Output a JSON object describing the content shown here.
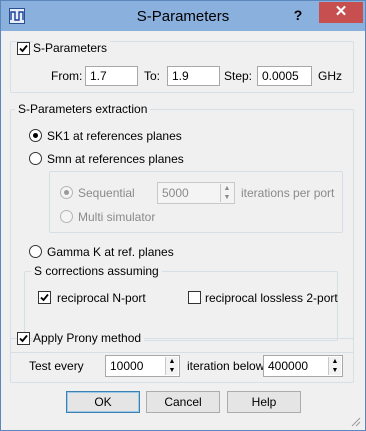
{
  "window": {
    "title": "S-Parameters",
    "help_label": "?",
    "close_label": "✕"
  },
  "sparams": {
    "checkbox_label": "S-Parameters",
    "checked": true,
    "from_label": "From:",
    "from_value": "1.7",
    "to_label": "To:",
    "to_value": "1.9",
    "step_label": "Step:",
    "step_value": "0.0005",
    "unit": "GHz"
  },
  "extraction": {
    "group_title": "S-Parameters extraction",
    "sk1_label": "SK1 at references planes",
    "smn_label": "Smn at references planes",
    "sequential_label": "Sequential",
    "sequential_value": "5000",
    "iterations_label": "iterations per port",
    "multisim_label": "Multi simulator",
    "gamma_label": "Gamma K at ref. planes",
    "selected": "sk1",
    "corrections": {
      "title": "S corrections assuming",
      "reciprocal_label": "reciprocal N-port",
      "reciprocal_checked": true,
      "lossless_label": "reciprocal lossless 2-port",
      "lossless_checked": false
    }
  },
  "prony": {
    "checkbox_label": "Apply Prony method",
    "checked": true,
    "test_every_label": "Test every",
    "test_every_value": "10000",
    "iteration_below_label": "iteration below",
    "iteration_below_value": "400000"
  },
  "buttons": {
    "ok": "OK",
    "cancel": "Cancel",
    "help": "Help"
  }
}
